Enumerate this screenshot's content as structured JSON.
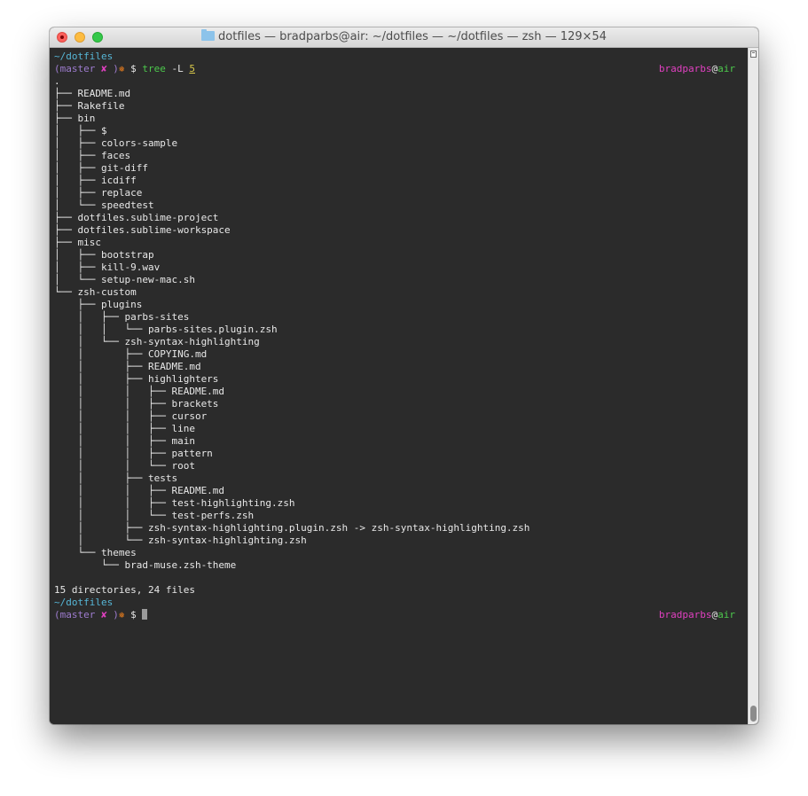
{
  "window": {
    "folder_name": "dotfiles",
    "title_rest": " — bradparbs@air: ~/dotfiles — ~/dotfiles — zsh — 129×54"
  },
  "prompt": {
    "path": "~/dotfiles",
    "branch_open": "(",
    "branch": "master",
    "dirty_mark": " ✘ ",
    "branch_close": ")",
    "state_glyph": "❅",
    "dollar": " $ ",
    "user": "bradparbs",
    "at": "@",
    "host": "air"
  },
  "command": {
    "name": "tree",
    "flag": " -L ",
    "arg": "5"
  },
  "tree_lines": [
    ".",
    "├── README.md",
    "├── Rakefile",
    "├── bin",
    "│   ├── $",
    "│   ├── colors-sample",
    "│   ├── faces",
    "│   ├── git-diff",
    "│   ├── icdiff",
    "│   ├── replace",
    "│   └── speedtest",
    "├── dotfiles.sublime-project",
    "├── dotfiles.sublime-workspace",
    "├── misc",
    "│   ├── bootstrap",
    "│   ├── kill-9.wav",
    "│   └── setup-new-mac.sh",
    "└── zsh-custom",
    "    ├── plugins",
    "    │   ├── parbs-sites",
    "    │   │   └── parbs-sites.plugin.zsh",
    "    │   └── zsh-syntax-highlighting",
    "    │       ├── COPYING.md",
    "    │       ├── README.md",
    "    │       ├── highlighters",
    "    │       │   ├── README.md",
    "    │       │   ├── brackets",
    "    │       │   ├── cursor",
    "    │       │   ├── line",
    "    │       │   ├── main",
    "    │       │   ├── pattern",
    "    │       │   └── root",
    "    │       ├── tests",
    "    │       │   ├── README.md",
    "    │       │   ├── test-highlighting.zsh",
    "    │       │   └── test-perfs.zsh",
    "    │       ├── zsh-syntax-highlighting.plugin.zsh -> zsh-syntax-highlighting.zsh",
    "    │       └── zsh-syntax-highlighting.zsh",
    "    └── themes",
    "        └── brad-muse.zsh-theme"
  ],
  "summary": "15 directories, 24 files",
  "colors": {
    "path": "#56b6d6",
    "branch": "#9e7ccf",
    "dirty": "#e040c0",
    "state": "#e07a1e",
    "command": "#4cc84c",
    "arg": "#d8c84a",
    "user": "#e040c0",
    "host": "#4cc84c",
    "background": "#2b2b2b"
  }
}
